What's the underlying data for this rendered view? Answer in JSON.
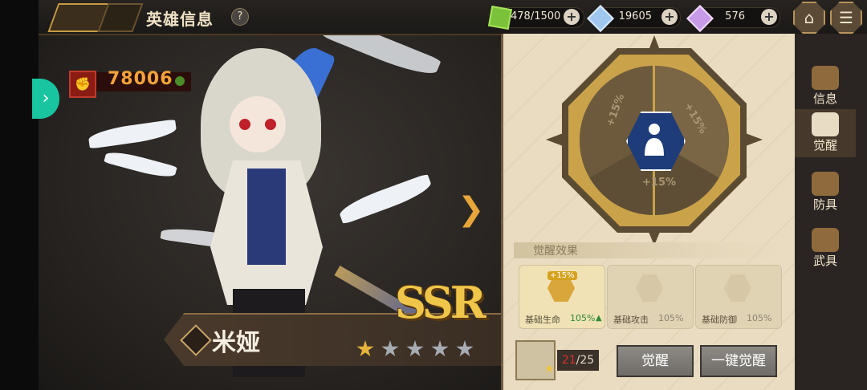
{
  "header": {
    "title": "英雄信息",
    "help_label": "?"
  },
  "resources": [
    {
      "name": "stamina",
      "icon": "green-cube-icon",
      "value": "478/1500"
    },
    {
      "name": "blue-diamond",
      "icon": "blue-diamond-icon",
      "value": "19605"
    },
    {
      "name": "purple-crystal",
      "icon": "purple-crystal-icon",
      "value": "576"
    }
  ],
  "hero": {
    "power": "78006",
    "name": "米娅",
    "rarity": "SSR",
    "stars_filled": 1,
    "stars_total": 5
  },
  "awaken": {
    "segment_labels": [
      "+15%",
      "+15%",
      "+15%"
    ],
    "effects_title": "觉醒效果",
    "effects": [
      {
        "label": "基础生命",
        "value": "105%",
        "bonus": "+15%",
        "active": true
      },
      {
        "label": "基础攻击",
        "value": "105%",
        "bonus": "",
        "active": false
      },
      {
        "label": "基础防御",
        "value": "105%",
        "bonus": "",
        "active": false
      }
    ],
    "material_owned": "21",
    "material_needed": "/25",
    "awaken_button": "觉醒",
    "one_click_button": "一键觉醒"
  },
  "tabs": [
    {
      "label": "信息",
      "active": false
    },
    {
      "label": "觉醒",
      "active": true
    },
    {
      "label": "防具",
      "active": false
    },
    {
      "label": "武具",
      "active": false
    }
  ],
  "colors": {
    "accent_gold": "#caa24a",
    "power_orange": "#f3a33b",
    "bonus_green": "#2e8b3a",
    "count_red": "#d2322a",
    "side_teal": "#19c4a0"
  }
}
